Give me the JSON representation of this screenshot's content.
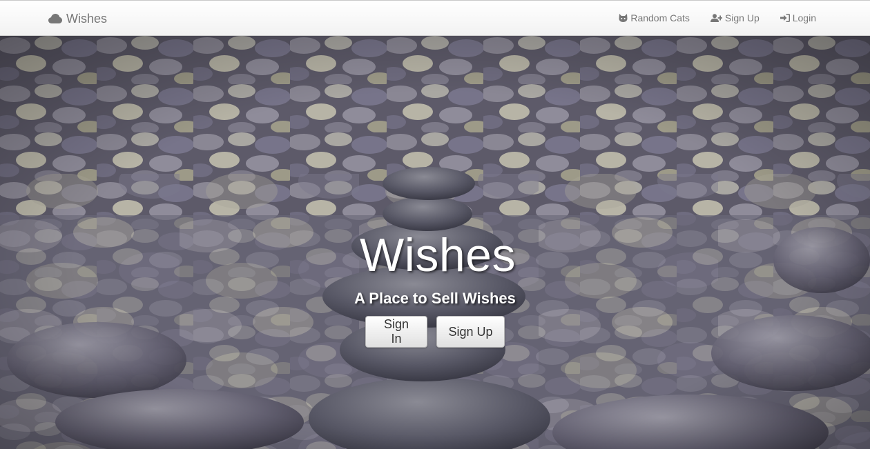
{
  "navbar": {
    "brand": {
      "icon": "cloud-icon",
      "label": "Wishes"
    },
    "links": [
      {
        "icon": "cat-icon",
        "label": "Random Cats"
      },
      {
        "icon": "user-plus-icon",
        "label": "Sign Up"
      },
      {
        "icon": "sign-in-icon",
        "label": "Login"
      }
    ]
  },
  "hero": {
    "background": "stacked-stones-photo",
    "title": "Wishes",
    "subtitle": "A Place to Sell Wishes",
    "buttons": {
      "sign_in": "Sign In",
      "sign_up": "Sign Up"
    }
  },
  "colors": {
    "navbar_bg": "#f8f8f8",
    "nav_text": "#777777",
    "hero_text": "#ffffff",
    "button_text": "#333333"
  }
}
